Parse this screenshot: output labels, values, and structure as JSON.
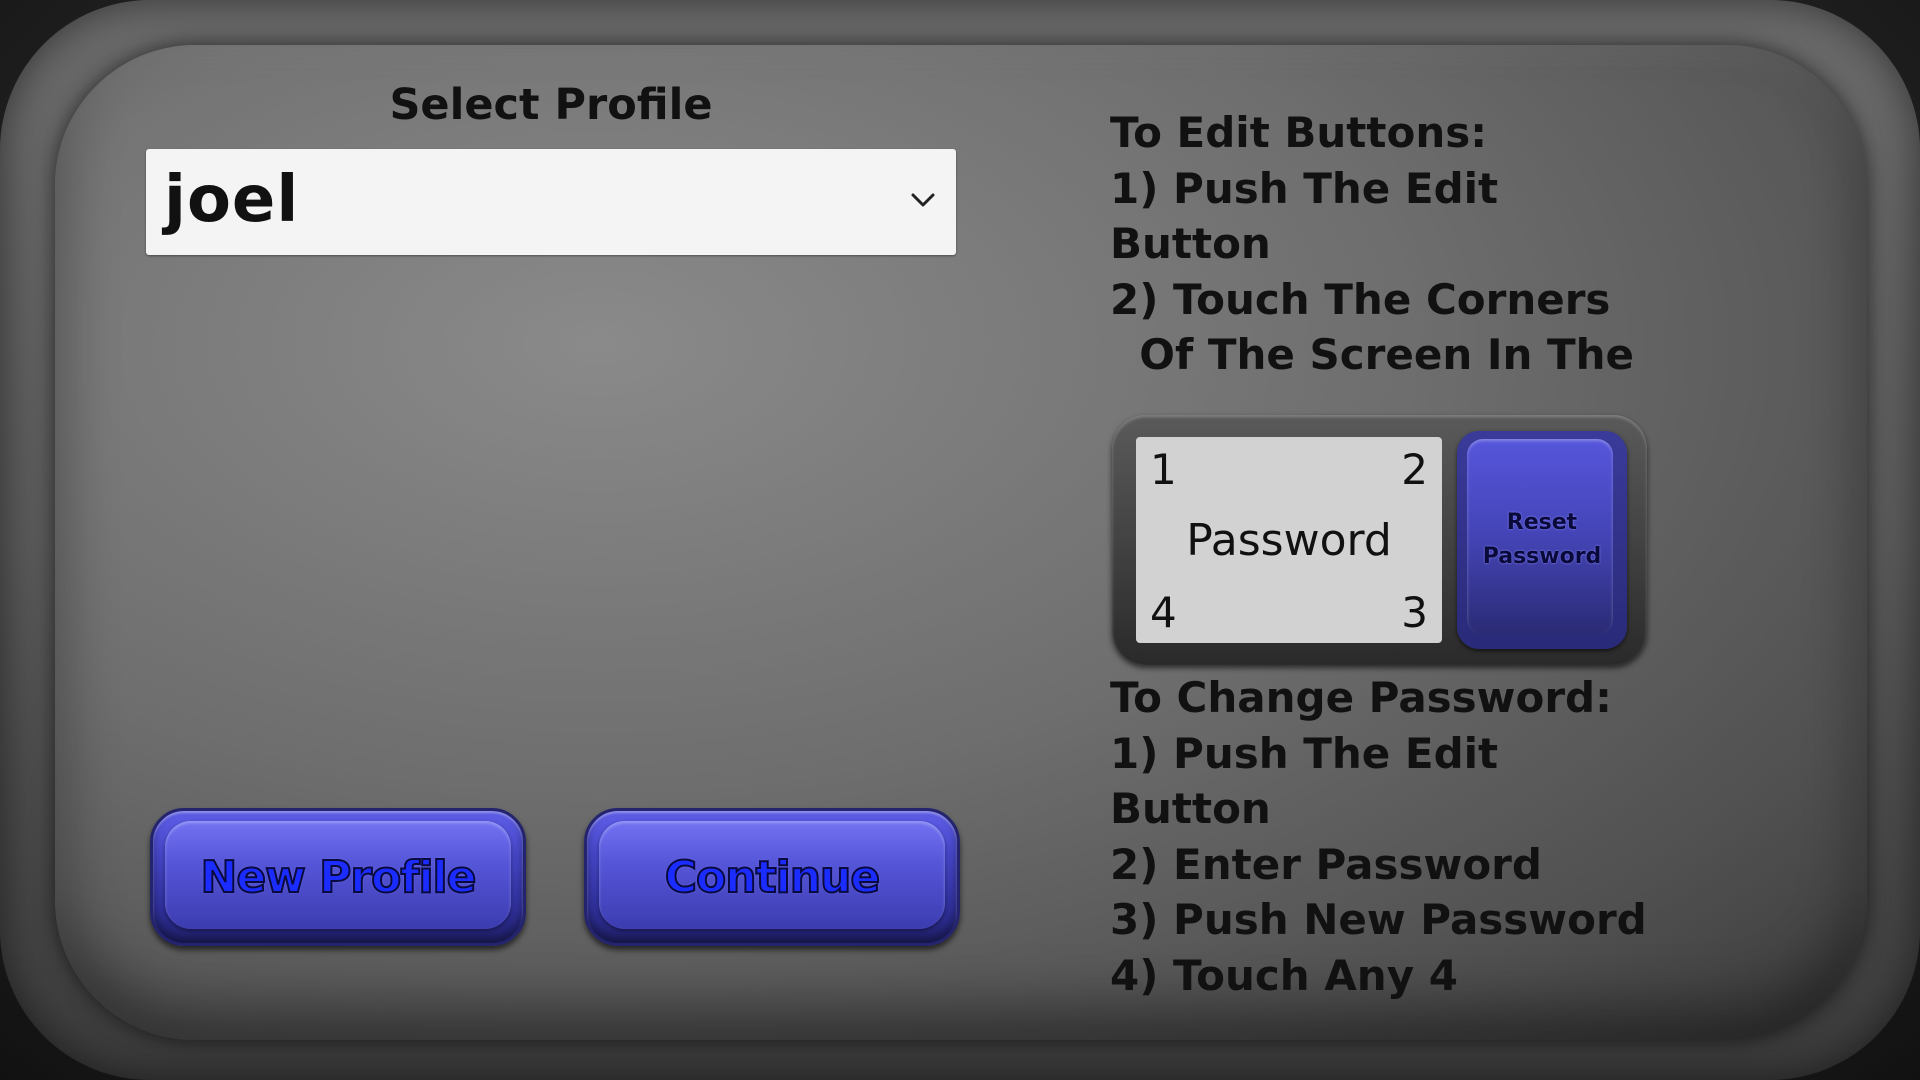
{
  "profile": {
    "label": "Select Profile",
    "selected": "joel"
  },
  "buttons": {
    "new_profile": "New Profile",
    "continue": "Continue"
  },
  "instructions_edit": {
    "lines": "To Edit Buttons:\n1) Push The Edit\nButton\n2) Touch The Corners\n  Of The Screen In The"
  },
  "password_widget": {
    "corner_1": "1",
    "corner_2": "2",
    "corner_3": "3",
    "corner_4": "4",
    "label": "Password",
    "reset_label": "Reset\nPassword"
  },
  "instructions_password": {
    "lines": "To Change Password:\n1) Push The Edit\nButton\n2) Enter Password\n3) Push New Password\n4) Touch Any 4"
  },
  "colors": {
    "button_blue": "#4646c8",
    "button_text": "#1a2cff",
    "panel_gray": "#6e6e6e"
  }
}
